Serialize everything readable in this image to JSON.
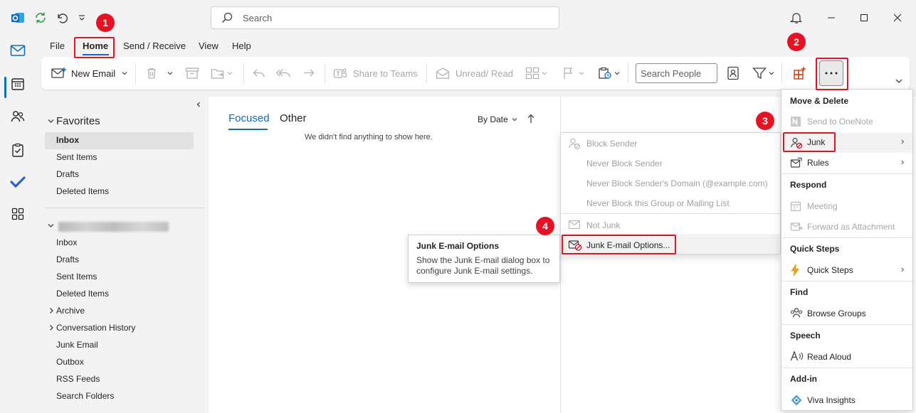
{
  "titlebar": {
    "search_placeholder": "Search"
  },
  "menu": {
    "tabs": [
      "File",
      "Home",
      "Send / Receive",
      "View",
      "Help"
    ]
  },
  "ribbon": {
    "new_email": "New Email",
    "share_to_teams": "Share to Teams",
    "unread_read": "Unread/ Read",
    "search_people_placeholder": "Search People"
  },
  "folders": {
    "favorites_label": "Favorites",
    "favorites": [
      "Inbox",
      "Sent Items",
      "Drafts",
      "Deleted Items"
    ],
    "account_folders": [
      "Inbox",
      "Drafts",
      "Sent Items",
      "Deleted Items",
      "Archive",
      "Conversation History",
      "Junk Email",
      "Outbox",
      "RSS Feeds",
      "Search Folders"
    ]
  },
  "message_list": {
    "tab_focused": "Focused",
    "tab_other": "Other",
    "sort_label": "By Date",
    "empty_text": "We didn't find anything to show here."
  },
  "junk_submenu": {
    "items": [
      "Block Sender",
      "Never Block Sender",
      "Never Block Sender's Domain (@example.com)",
      "Never Block this Group or Mailing List",
      "Not Junk",
      "Junk E-mail Options..."
    ]
  },
  "tooltip": {
    "title": "Junk E-mail Options",
    "body": "Show the Junk E-mail dialog box to configure Junk E-mail settings."
  },
  "more_menu": {
    "section_move_delete": "Move & Delete",
    "send_to_onenote": "Send to OneNote",
    "junk": "Junk",
    "rules": "Rules",
    "section_respond": "Respond",
    "meeting": "Meeting",
    "forward_as_attachment": "Forward as Attachment",
    "section_quick_steps": "Quick Steps",
    "quick_steps": "Quick Steps",
    "section_find": "Find",
    "browse_groups": "Browse Groups",
    "section_speech": "Speech",
    "read_aloud": "Read Aloud",
    "section_addin": "Add-in",
    "viva_insights": "Viva Insights"
  },
  "annotations": {
    "steps": [
      "1",
      "2",
      "3",
      "4"
    ]
  },
  "colors": {
    "accent": "#0f6cbd",
    "annotation_red": "#e81123"
  }
}
